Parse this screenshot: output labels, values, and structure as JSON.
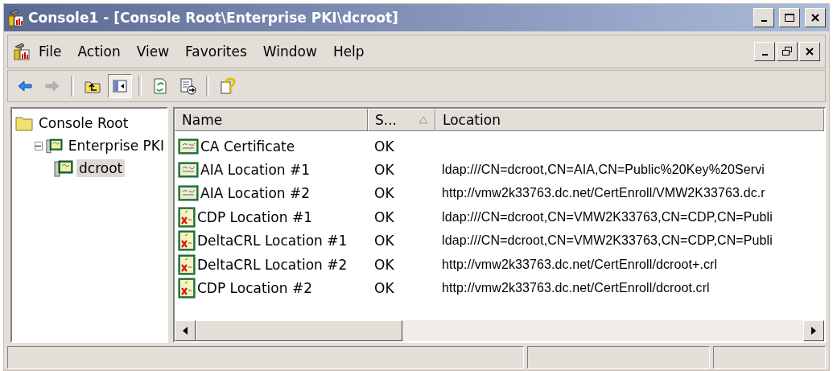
{
  "window": {
    "title": "Console1 - [Console Root\\Enterprise PKI\\dcroot]"
  },
  "menu": [
    {
      "label": "File"
    },
    {
      "label": "Action"
    },
    {
      "label": "View"
    },
    {
      "label": "Favorites"
    },
    {
      "label": "Window"
    },
    {
      "label": "Help"
    }
  ],
  "toolbar": [
    {
      "kind": "back",
      "disabled": false
    },
    {
      "kind": "forward",
      "disabled": true
    },
    {
      "kind": "sep"
    },
    {
      "kind": "up",
      "disabled": false
    },
    {
      "kind": "tree",
      "disabled": false,
      "pressed": true
    },
    {
      "kind": "sep"
    },
    {
      "kind": "refresh",
      "disabled": false
    },
    {
      "kind": "export",
      "disabled": false
    },
    {
      "kind": "sep"
    },
    {
      "kind": "help",
      "disabled": false
    }
  ],
  "tree": [
    {
      "label": "Console Root",
      "kind": "folder",
      "selected": false,
      "children": [
        {
          "label": "Enterprise PKI",
          "kind": "pki",
          "selected": false,
          "expanded": true,
          "children": [
            {
              "label": "dcroot",
              "kind": "pki",
              "selected": true
            }
          ]
        }
      ]
    }
  ],
  "table": {
    "columns": [
      {
        "label": "Name",
        "sorted": false
      },
      {
        "label": "S...",
        "sorted": true
      },
      {
        "label": "Location",
        "sorted": false
      }
    ],
    "rows": [
      {
        "kind": "certificate",
        "name": "CA Certificate",
        "status": "OK"
      },
      {
        "kind": "certificate",
        "name": "AIA Location #1",
        "status": "OK",
        "location": "ldap:///CN=dcroot,CN=AIA,CN=Public%20Key%20Servi"
      },
      {
        "kind": "certificate",
        "name": "AIA Location #2",
        "status": "OK",
        "location": "http://vmw2k33763.dc.net/CertEnroll/VMW2K33763.dc.r"
      },
      {
        "kind": "crl",
        "name": "CDP Location #1",
        "status": "OK",
        "location": "ldap:///CN=dcroot,CN=VMW2K33763,CN=CDP,CN=Publi"
      },
      {
        "kind": "crl",
        "name": "DeltaCRL Location #1",
        "status": "OK",
        "location": "ldap:///CN=dcroot,CN=VMW2K33763,CN=CDP,CN=Publi"
      },
      {
        "kind": "crl",
        "name": "DeltaCRL Location #2",
        "status": "OK",
        "location": "http://vmw2k33763.dc.net/CertEnroll/dcroot+.crl"
      },
      {
        "kind": "crl",
        "name": "CDP Location #2",
        "status": "OK",
        "location": "http://vmw2k33763.dc.net/CertEnroll/dcroot.crl"
      }
    ]
  }
}
